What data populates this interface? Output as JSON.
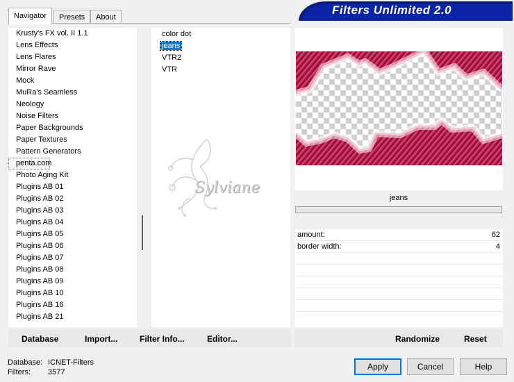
{
  "tabs": [
    "Navigator",
    "Presets",
    "About"
  ],
  "title": "Filters Unlimited 2.0",
  "categories": [
    "Krusty's FX vol. II 1.1",
    "Lens Effects",
    "Lens Flares",
    "Mirror Rave",
    "Mock",
    "MuRa's Seamless",
    "Neology",
    "Noise Filters",
    "Paper Backgrounds",
    "Paper Textures",
    "Pattern Generators",
    "penta.com",
    "Photo Aging Kit",
    "Plugins AB 01",
    "Plugins AB 02",
    "Plugins AB 03",
    "Plugins AB 04",
    "Plugins AB 05",
    "Plugins AB 06",
    "Plugins AB 07",
    "Plugins AB 08",
    "Plugins AB 09",
    "Plugins AB 10",
    "Plugins AB 16",
    "Plugins AB 21"
  ],
  "selected_category": "penta.com",
  "filters": [
    "color dot",
    "jeans",
    "VTR2",
    "VTR"
  ],
  "selected_filter": "jeans",
  "watermark": "Sylviane",
  "filter_name": "jeans",
  "params": [
    {
      "label": "amount:",
      "value": "62"
    },
    {
      "label": "border width:",
      "value": "4"
    }
  ],
  "left_buttons": {
    "database": "Database",
    "import": "Import...",
    "filter_info": "Filter Info...",
    "editor": "Editor..."
  },
  "right_buttons": {
    "randomize": "Randomize",
    "reset": "Reset"
  },
  "status": {
    "database_label": "Database:",
    "database_value": "ICNET-Filters",
    "filters_label": "Filters:",
    "filters_value": "3577"
  },
  "dialog_buttons": {
    "apply": "Apply",
    "cancel": "Cancel",
    "help": "Help"
  },
  "colors": {
    "preview_pink": "#c01f4f",
    "banner_blue": "#0b23a6",
    "selection": "#0078d7"
  }
}
